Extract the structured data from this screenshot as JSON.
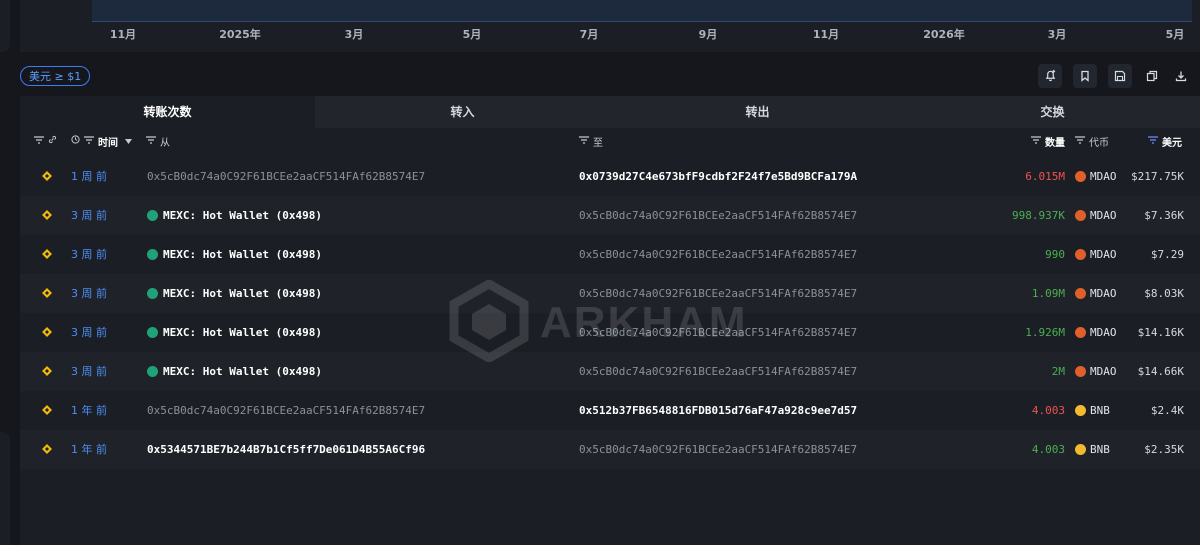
{
  "chart": {
    "x_ticks": [
      "11月",
      "2025年",
      "3月",
      "5月",
      "7月",
      "9月",
      "11月",
      "2026年",
      "3月",
      "5月"
    ]
  },
  "filter_chip": "美元 ≥ $1",
  "tabs": [
    "转账次数",
    "转入",
    "转出",
    "交换"
  ],
  "header": {
    "time": "时间",
    "from": "从",
    "to": "至",
    "amount": "数量",
    "token": "代币",
    "usd": "美元"
  },
  "rows": [
    {
      "time": "1 周 前",
      "from": "0x5cB0dc74a0C92F61BCEe2aaCF514FAf62B8574E7",
      "to": "0x0739d27C4e673bfF9cdbf2F24f7e5Bd9BCFa179A",
      "amount": "6.015M",
      "token": "MDAO",
      "usd": "$217.75K",
      "dir": "out"
    },
    {
      "time": "3 周 前",
      "from": "MEXC: Hot Wallet (0x498)",
      "to": "0x5cB0dc74a0C92F61BCEe2aaCF514FAf62B8574E7",
      "amount": "998.937K",
      "token": "MDAO",
      "usd": "$7.36K",
      "dir": "in"
    },
    {
      "time": "3 周 前",
      "from": "MEXC: Hot Wallet (0x498)",
      "to": "0x5cB0dc74a0C92F61BCEe2aaCF514FAf62B8574E7",
      "amount": "990",
      "token": "MDAO",
      "usd": "$7.29",
      "dir": "in"
    },
    {
      "time": "3 周 前",
      "from": "MEXC: Hot Wallet (0x498)",
      "to": "0x5cB0dc74a0C92F61BCEe2aaCF514FAf62B8574E7",
      "amount": "1.09M",
      "token": "MDAO",
      "usd": "$8.03K",
      "dir": "in"
    },
    {
      "time": "3 周 前",
      "from": "MEXC: Hot Wallet (0x498)",
      "to": "0x5cB0dc74a0C92F61BCEe2aaCF514FAf62B8574E7",
      "amount": "1.926M",
      "token": "MDAO",
      "usd": "$14.16K",
      "dir": "in"
    },
    {
      "time": "3 周 前",
      "from": "MEXC: Hot Wallet (0x498)",
      "to": "0x5cB0dc74a0C92F61BCEe2aaCF514FAf62B8574E7",
      "amount": "2M",
      "token": "MDAO",
      "usd": "$14.66K",
      "dir": "in"
    },
    {
      "time": "1 年 前",
      "from": "0x5cB0dc74a0C92F61BCEe2aaCF514FAf62B8574E7",
      "to": "0x512b37FB6548816FDB015d76aF47a928c9ee7d57",
      "amount": "4.003",
      "token": "BNB",
      "usd": "$2.4K",
      "dir": "out"
    },
    {
      "time": "1 年 前",
      "from": "0x5344571BE7b244B7b1Cf5ff7De061D4B55A6Cf96",
      "to": "0x5cB0dc74a0C92F61BCEe2aaCF514FAf62B8574E7",
      "amount": "4.003",
      "token": "BNB",
      "usd": "$2.35K",
      "dir": "in"
    }
  ],
  "watermark": "ARKHAM",
  "colors": {
    "accent": "#3b7df3",
    "out_amount": "#ef5350",
    "in_amount": "#4caf50",
    "mdao_icon": "#e0602a",
    "bnb_icon": "#f3ba2f",
    "entity_icon": "#1fa27a",
    "chain_icon": "#f0b90b"
  }
}
